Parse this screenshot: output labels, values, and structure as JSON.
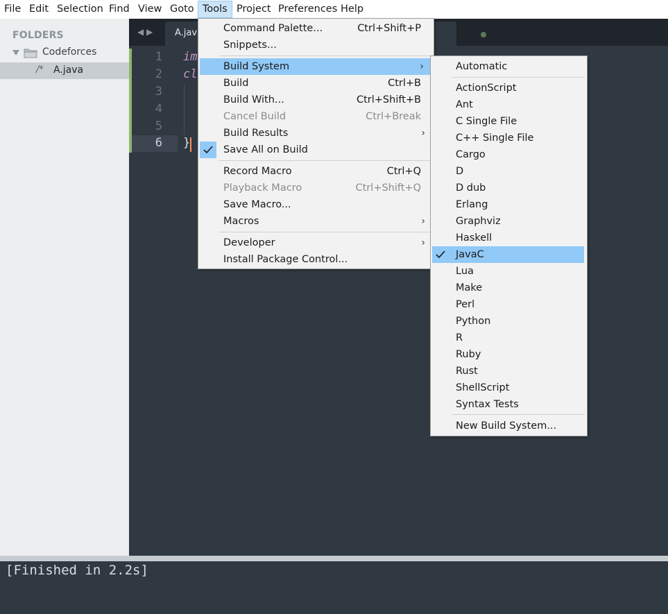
{
  "menubar": {
    "items": [
      "File",
      "Edit",
      "Selection",
      "Find",
      "View",
      "Goto",
      "Tools",
      "Project",
      "Preferences",
      "Help"
    ]
  },
  "sidebar": {
    "title": "FOLDERS",
    "folder": "Codeforces",
    "file_icon": "/*",
    "file": "A.java"
  },
  "editor": {
    "tab_label": "A.java",
    "line_numbers": [
      "1",
      "2",
      "3",
      "4",
      "5",
      "6"
    ],
    "code_line1": "im",
    "code_line2": "cl",
    "code_line6": "}"
  },
  "output": {
    "text": "[Finished in 2.2s]"
  },
  "tools_menu": {
    "command_palette": "Command Palette...",
    "command_palette_sc": "Ctrl+Shift+P",
    "snippets": "Snippets...",
    "build_system": "Build System",
    "build": "Build",
    "build_sc": "Ctrl+B",
    "build_with": "Build With...",
    "build_with_sc": "Ctrl+Shift+B",
    "cancel_build": "Cancel Build",
    "cancel_build_sc": "Ctrl+Break",
    "build_results": "Build Results",
    "save_all_on_build": "Save All on Build",
    "record_macro": "Record Macro",
    "record_macro_sc": "Ctrl+Q",
    "playback_macro": "Playback Macro",
    "playback_macro_sc": "Ctrl+Shift+Q",
    "save_macro": "Save Macro...",
    "macros": "Macros",
    "developer": "Developer",
    "install_package_control": "Install Package Control..."
  },
  "build_system_menu": {
    "automatic": "Automatic",
    "systems": [
      "ActionScript",
      "Ant",
      "C Single File",
      "C++ Single File",
      "Cargo",
      "D",
      "D dub",
      "Erlang",
      "Graphviz",
      "Haskell",
      "JavaC",
      "Lua",
      "Make",
      "Perl",
      "Python",
      "R",
      "Ruby",
      "Rust",
      "ShellScript",
      "Syntax Tests"
    ],
    "selected": "JavaC",
    "new_build_system": "New Build System..."
  }
}
